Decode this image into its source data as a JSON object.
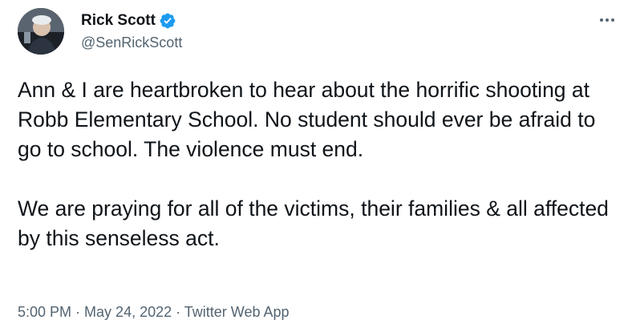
{
  "author": {
    "display_name": "Rick Scott",
    "handle": "@SenRickScott",
    "verified": true,
    "avatar_icon": "profile-photo"
  },
  "tweet": {
    "paragraphs": [
      "Ann & I are heartbroken to hear about the horrific shooting at Robb Elementary School. No student should ever be afraid to go to school. The violence must end.",
      "We are praying for all of the victims, their families & all affected by this senseless act."
    ]
  },
  "meta": {
    "time": "5:00 PM",
    "separator": " · ",
    "date": "May 24, 2022",
    "source": "Twitter Web App"
  },
  "colors": {
    "verified_blue": "#1d9bf0",
    "secondary_text": "#536471",
    "primary_text": "#0f1419"
  }
}
